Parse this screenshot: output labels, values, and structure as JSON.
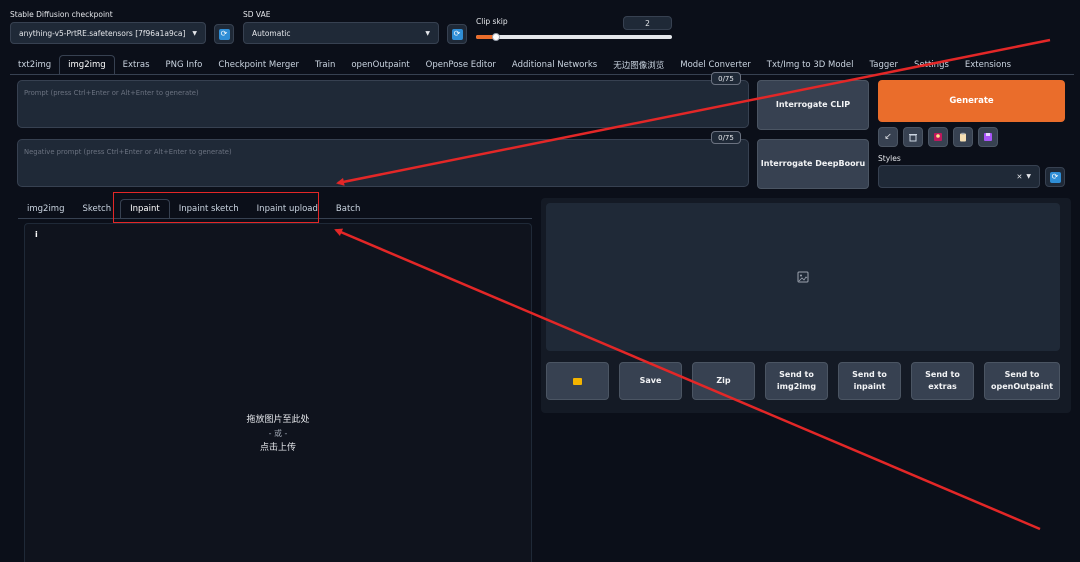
{
  "checkpoint": {
    "label": "Stable Diffusion checkpoint",
    "value": "anything-v5-PrtRE.safetensors [7f96a1a9ca]"
  },
  "vae": {
    "label": "SD VAE",
    "value": "Automatic"
  },
  "clip_skip": {
    "label": "Clip skip",
    "value": "2",
    "slider_fraction": 0.1
  },
  "main_tabs": [
    "txt2img",
    "img2img",
    "Extras",
    "PNG Info",
    "Checkpoint Merger",
    "Train",
    "openOutpaint",
    "OpenPose Editor",
    "Additional Networks",
    "无边图像浏览",
    "Model Converter",
    "Txt/Img to 3D Model",
    "Tagger",
    "Settings",
    "Extensions"
  ],
  "main_tabs_active": "img2img",
  "prompt": {
    "placeholder": "Prompt (press Ctrl+Enter or Alt+Enter to generate)",
    "counter": "0/75"
  },
  "negative_prompt": {
    "placeholder": "Negative prompt (press Ctrl+Enter or Alt+Enter to generate)",
    "counter": "0/75"
  },
  "buttons": {
    "interrogate_clip": "Interrogate CLIP",
    "interrogate_deepbooru": "Interrogate DeepBooru",
    "generate": "Generate"
  },
  "styles": {
    "label": "Styles",
    "clear_glyph": "✕"
  },
  "sub_tabs": [
    "img2img",
    "Sketch",
    "Inpaint",
    "Inpaint sketch",
    "Inpaint upload",
    "Batch"
  ],
  "sub_tabs_active": "Inpaint",
  "canvas": {
    "info_glyph": "i",
    "drop_line1": "拖放图片至此处",
    "drop_line2": "- 或 -",
    "drop_line3": "点击上传"
  },
  "output_buttons": {
    "save": "Save",
    "zip": "Zip",
    "send_img2img": [
      "Send to",
      "img2img"
    ],
    "send_inpaint": [
      "Send to",
      "inpaint"
    ],
    "send_extras": [
      "Send to",
      "extras"
    ],
    "send_outpaint": [
      "Send to",
      "openOutpaint"
    ]
  },
  "colors": {
    "accent": "#ea6d2b",
    "annotation": "#e32727",
    "background": "#0b0f19"
  },
  "icons": [
    "refresh-icon",
    "folder-icon",
    "image-placeholder-icon",
    "paste-arrow-icon",
    "trash-icon",
    "extra-networks-icon",
    "clipboard-icon",
    "save-style-icon"
  ]
}
